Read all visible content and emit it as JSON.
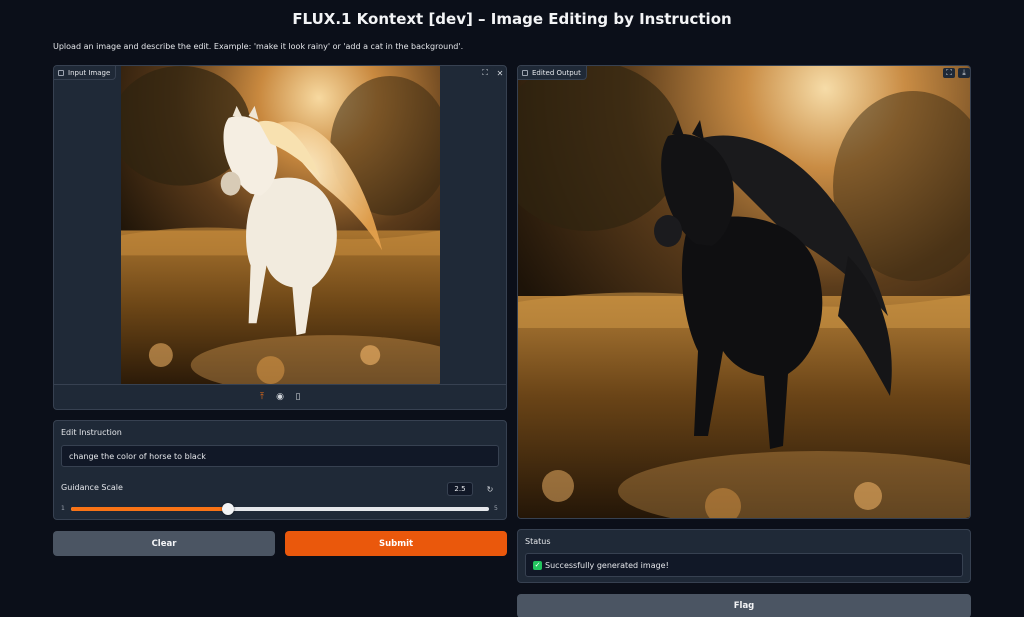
{
  "header": {
    "title": "FLUX.1 Kontext [dev] – Image Editing by Instruction",
    "description": "Upload an image and describe the edit. Example: 'make it look rainy' or 'add a cat in the background'."
  },
  "input_panel": {
    "label": "Input Image",
    "label_icon": "image-icon",
    "fullscreen_icon": "fullscreen-icon",
    "close_icon": "close-icon",
    "toolbar_icons": [
      "upload-icon",
      "webcam-icon",
      "clipboard-icon"
    ],
    "image_subject": "white horse running through golden meadow"
  },
  "output_panel": {
    "label": "Edited Output",
    "label_icon": "image-icon",
    "fullscreen_icon": "fullscreen-icon",
    "download_icon": "download-icon",
    "image_subject": "black horse running through golden meadow"
  },
  "instruction": {
    "label": "Edit Instruction",
    "value": "change the color of horse to black"
  },
  "guidance": {
    "label": "Guidance Scale",
    "value": "2.5",
    "min_label": "1",
    "max_label": "5",
    "fraction": 0.375,
    "reset_icon": "reset-icon"
  },
  "buttons": {
    "clear": "Clear",
    "submit": "Submit",
    "flag": "Flag"
  },
  "status": {
    "label": "Status",
    "icon": "check-icon",
    "text": "Successfully generated image!"
  },
  "colors": {
    "background": "#0b0f19",
    "panel": "#1f2937",
    "accent": "#ea580c",
    "secondary_button": "#4b5563",
    "success": "#22c55e"
  }
}
